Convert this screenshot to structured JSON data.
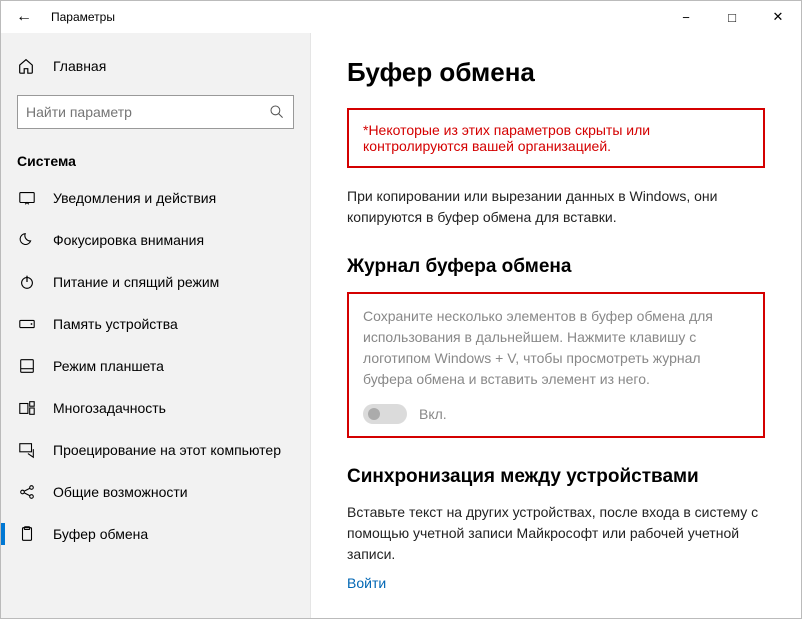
{
  "titlebar": {
    "title": "Параметры"
  },
  "sidebar": {
    "home": "Главная",
    "search_placeholder": "Найти параметр",
    "section": "Система",
    "items": [
      {
        "label": "Уведомления и действия"
      },
      {
        "label": "Фокусировка внимания"
      },
      {
        "label": "Питание и спящий режим"
      },
      {
        "label": "Память устройства"
      },
      {
        "label": "Режим планшета"
      },
      {
        "label": "Многозадачность"
      },
      {
        "label": "Проецирование на этот компьютер"
      },
      {
        "label": "Общие возможности"
      },
      {
        "label": "Буфер обмена"
      }
    ]
  },
  "main": {
    "heading": "Буфер обмена",
    "warning": "*Некоторые из этих параметров скрыты или контролируются вашей организацией.",
    "intro": "При копировании или вырезании данных в Windows, они копируются в буфер обмена для вставки.",
    "history_title": "Журнал буфера обмена",
    "history_desc": "Сохраните несколько элементов в буфер обмена для использования в дальнейшем. Нажмите клавишу с логотипом Windows + V, чтобы просмотреть журнал буфера обмена и вставить элемент из него.",
    "toggle_label": "Вкл.",
    "sync_title": "Синхронизация между устройствами",
    "sync_desc": "Вставьте текст на других устройствах, после входа в систему с помощью учетной записи Майкрософт или рабочей учетной записи.",
    "signin": "Войти"
  }
}
